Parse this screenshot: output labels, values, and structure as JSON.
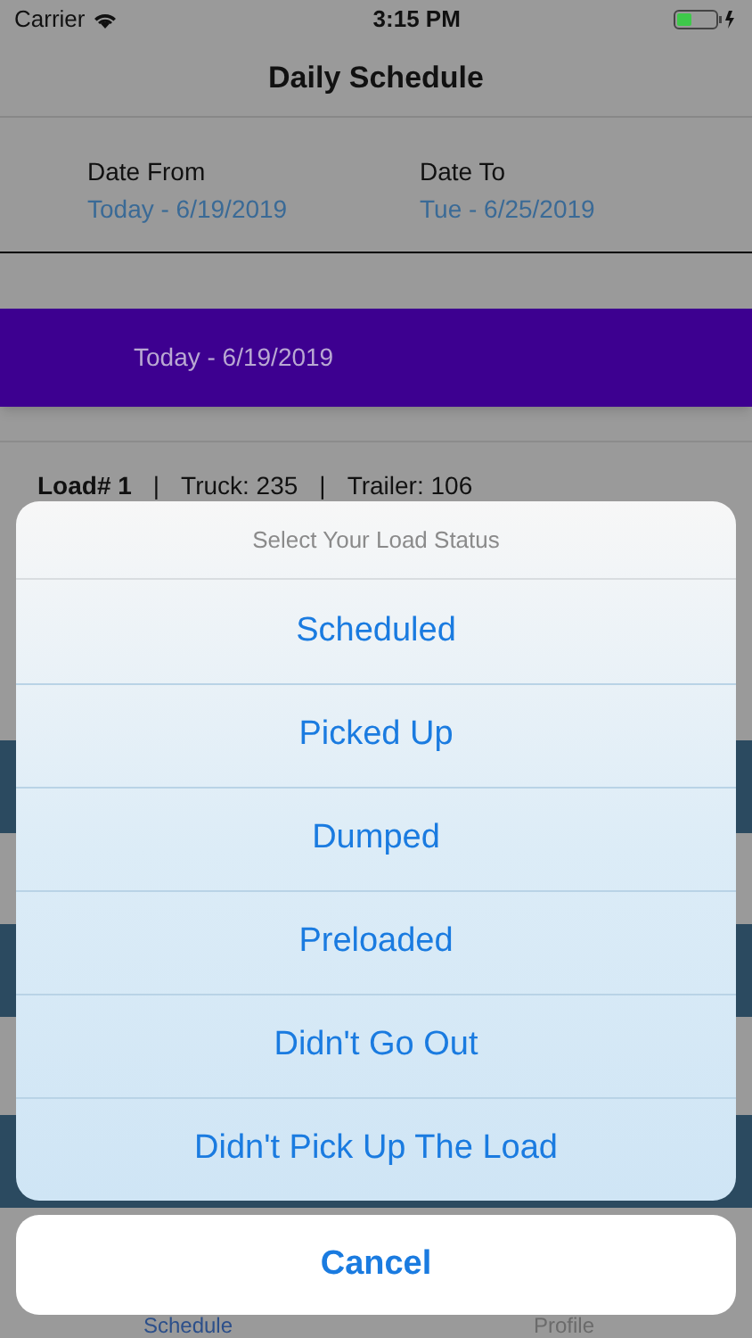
{
  "status_bar": {
    "carrier": "Carrier",
    "time": "3:15 PM"
  },
  "nav": {
    "title": "Daily Schedule"
  },
  "date_range": [
    {
      "label": "Date From",
      "value": "Today - 6/19/2019"
    },
    {
      "label": "Date To",
      "value": "Tue - 6/25/2019"
    }
  ],
  "selected_day": "Today - 6/19/2019",
  "load": {
    "number": "Load# 1",
    "separator_1": "|",
    "truck": "Truck: 235",
    "separator_2": "|",
    "trailer": "Trailer: 106"
  },
  "action_sheet": {
    "title": "Select Your Load Status",
    "options": [
      "Scheduled",
      "Picked Up",
      "Dumped",
      "Preloaded",
      "Didn't Go Out",
      "Didn't Pick Up The Load"
    ],
    "cancel": "Cancel"
  },
  "tab_bar": [
    {
      "label": "Schedule",
      "selected": true
    },
    {
      "label": "Profile",
      "selected": false
    }
  ]
}
